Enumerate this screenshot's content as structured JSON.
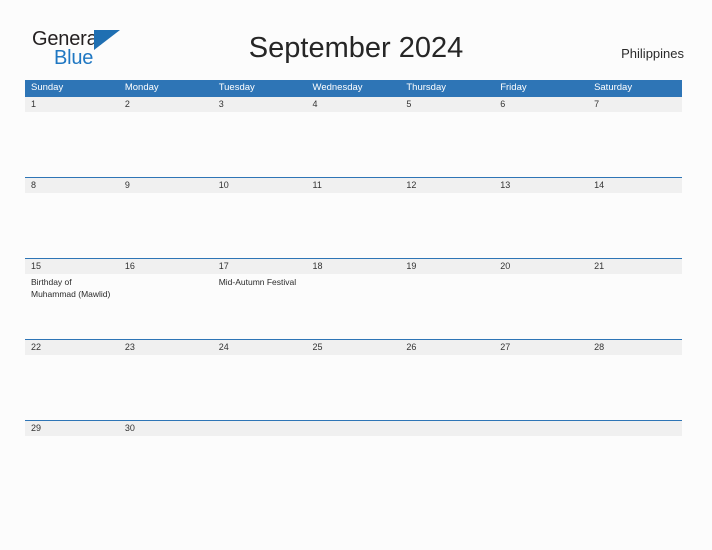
{
  "brand": {
    "name_part1": "General",
    "name_part2": "Blue",
    "triangle_icon": "blue-triangle-icon",
    "accent_color": "#1f6fb2"
  },
  "header": {
    "title": "September 2024",
    "region": "Philippines"
  },
  "calendar": {
    "header_color": "#2E75B6",
    "date_strip_color": "#F0F0F0",
    "weekdays": [
      "Sunday",
      "Monday",
      "Tuesday",
      "Wednesday",
      "Thursday",
      "Friday",
      "Saturday"
    ],
    "weeks": [
      {
        "dates": [
          "1",
          "2",
          "3",
          "4",
          "5",
          "6",
          "7"
        ],
        "events": [
          "",
          "",
          "",
          "",
          "",
          "",
          ""
        ]
      },
      {
        "dates": [
          "8",
          "9",
          "10",
          "11",
          "12",
          "13",
          "14"
        ],
        "events": [
          "",
          "",
          "",
          "",
          "",
          "",
          ""
        ]
      },
      {
        "dates": [
          "15",
          "16",
          "17",
          "18",
          "19",
          "20",
          "21"
        ],
        "events": [
          "Birthday of Muhammad (Mawlid)",
          "",
          "Mid-Autumn Festival",
          "",
          "",
          "",
          ""
        ]
      },
      {
        "dates": [
          "22",
          "23",
          "24",
          "25",
          "26",
          "27",
          "28"
        ],
        "events": [
          "",
          "",
          "",
          "",
          "",
          "",
          ""
        ]
      },
      {
        "dates": [
          "29",
          "30",
          "",
          "",
          "",
          "",
          ""
        ],
        "events": [
          "",
          "",
          "",
          "",
          "",
          "",
          ""
        ]
      }
    ]
  }
}
